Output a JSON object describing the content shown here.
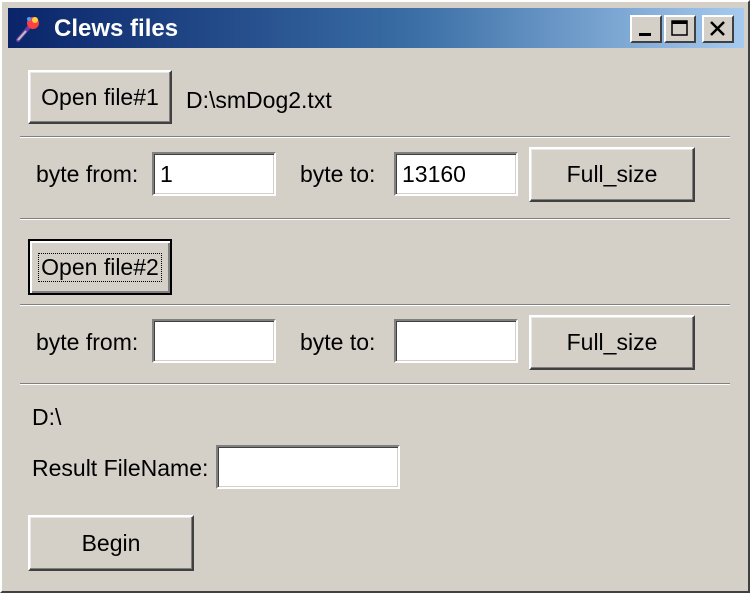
{
  "window": {
    "title": "Clews files",
    "controls": {
      "minimize": "minimize-icon",
      "maximize": "maximize-icon",
      "close": "close-icon"
    }
  },
  "file1": {
    "open_label": "Open file#1",
    "path": "D:\\smDog2.txt",
    "byte_from_label": "byte from:",
    "byte_from_value": "1",
    "byte_to_label": "byte to:",
    "byte_to_value": "13160",
    "full_size_label": "Full_size"
  },
  "file2": {
    "open_label": "Open file#2",
    "byte_from_label": "byte from:",
    "byte_from_value": "",
    "byte_to_label": "byte to:",
    "byte_to_value": "",
    "full_size_label": "Full_size"
  },
  "result": {
    "path": "D:\\",
    "filename_label": "Result FileName:",
    "filename_value": "",
    "begin_label": "Begin"
  }
}
